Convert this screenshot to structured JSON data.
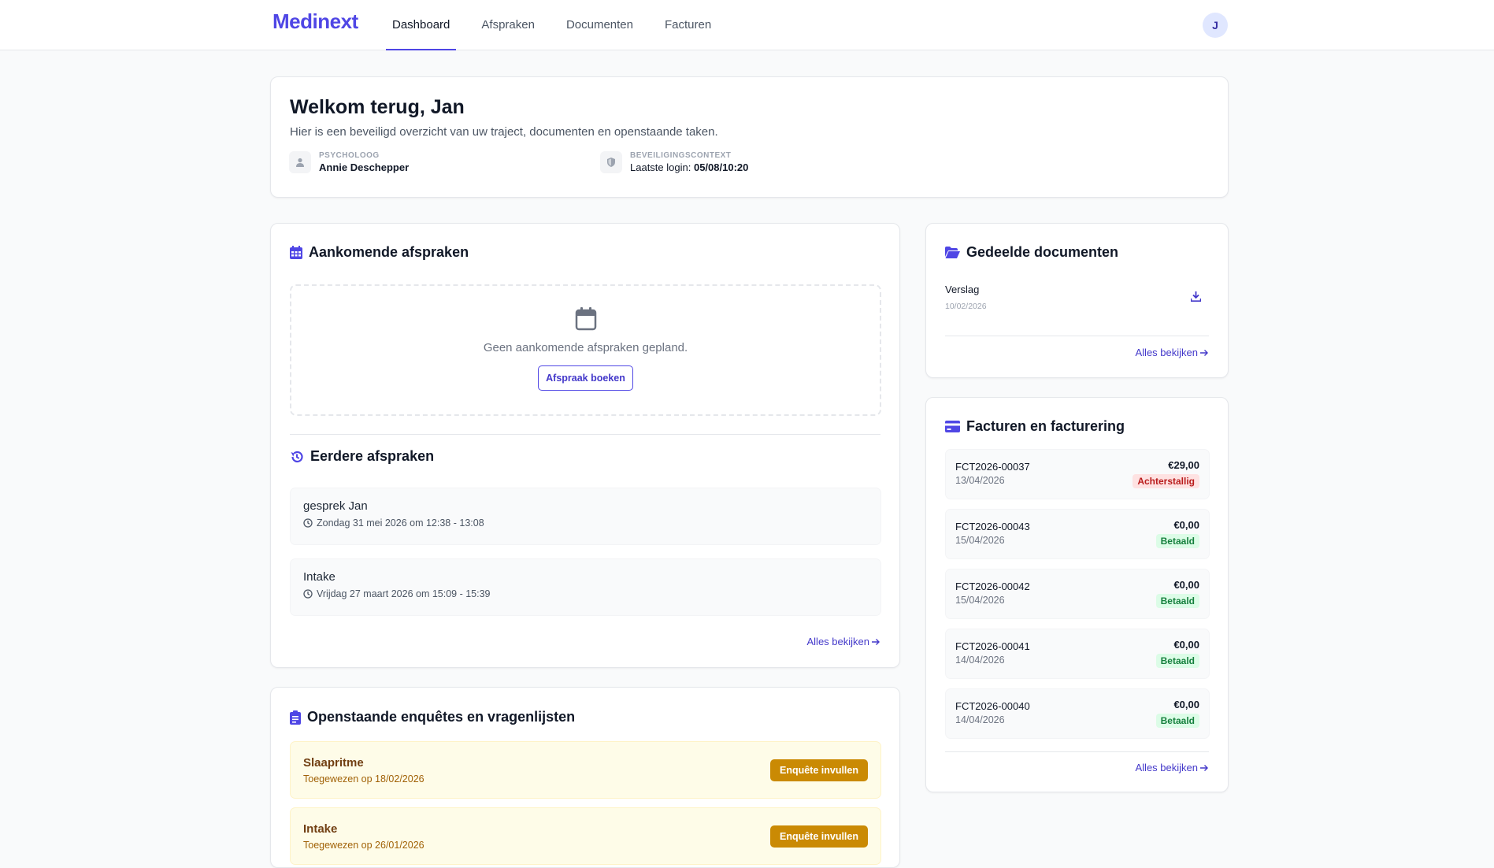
{
  "app": {
    "logo": "Medinext"
  },
  "nav": {
    "items": [
      {
        "label": "Dashboard",
        "active": true
      },
      {
        "label": "Afspraken",
        "active": false
      },
      {
        "label": "Documenten",
        "active": false
      },
      {
        "label": "Facturen",
        "active": false
      }
    ],
    "avatar_initial": "J"
  },
  "welcome": {
    "title": "Welkom terug, Jan",
    "subtitle": "Hier is een beveiligd overzicht van uw traject, documenten en openstaande taken.",
    "psychologist_label": "PSYCHOLOOG",
    "psychologist_name": "Annie Deschepper",
    "security_label": "BEVEILIGINGSCONTEXT",
    "last_login_label": "Laatste login:",
    "last_login_value": "05/08/10:20"
  },
  "appointments": {
    "title": "Aankomende afspraken",
    "empty_text": "Geen aankomende afspraken gepland.",
    "book_button": "Afspraak boeken",
    "past_title": "Eerdere afspraken",
    "past": [
      {
        "title": "gesprek Jan",
        "time": "Zondag 31 mei 2026 om 12:38 - 13:08"
      },
      {
        "title": "Intake",
        "time": "Vrijdag 27 maart 2026 om 15:09 - 15:39"
      }
    ],
    "view_all": "Alles bekijken"
  },
  "surveys": {
    "title": "Openstaande enquêtes en vragenlijsten",
    "items": [
      {
        "title": "Slaapritme",
        "assigned": "Toegewezen op 18/02/2026",
        "button": "Enquête invullen"
      },
      {
        "title": "Intake",
        "assigned": "Toegewezen op 26/01/2026",
        "button": "Enquête invullen"
      }
    ]
  },
  "documents": {
    "title": "Gedeelde documenten",
    "items": [
      {
        "name": "Verslag",
        "date": "10/02/2026"
      }
    ],
    "view_all": "Alles bekijken"
  },
  "invoices": {
    "title": "Facturen en facturering",
    "items": [
      {
        "number": "FCT2026-00037",
        "date": "13/04/2026",
        "amount": "€29,00",
        "status": "Achterstallig",
        "status_type": "late"
      },
      {
        "number": "FCT2026-00043",
        "date": "15/04/2026",
        "amount": "€0,00",
        "status": "Betaald",
        "status_type": "paid"
      },
      {
        "number": "FCT2026-00042",
        "date": "15/04/2026",
        "amount": "€0,00",
        "status": "Betaald",
        "status_type": "paid"
      },
      {
        "number": "FCT2026-00041",
        "date": "14/04/2026",
        "amount": "€0,00",
        "status": "Betaald",
        "status_type": "paid"
      },
      {
        "number": "FCT2026-00040",
        "date": "14/04/2026",
        "amount": "€0,00",
        "status": "Betaald",
        "status_type": "paid"
      }
    ],
    "view_all": "Alles bekijken"
  },
  "colors": {
    "accent": "#4f46e5",
    "late": "#b91c1c",
    "paid": "#15803d",
    "survey_button": "#ca8a04"
  }
}
